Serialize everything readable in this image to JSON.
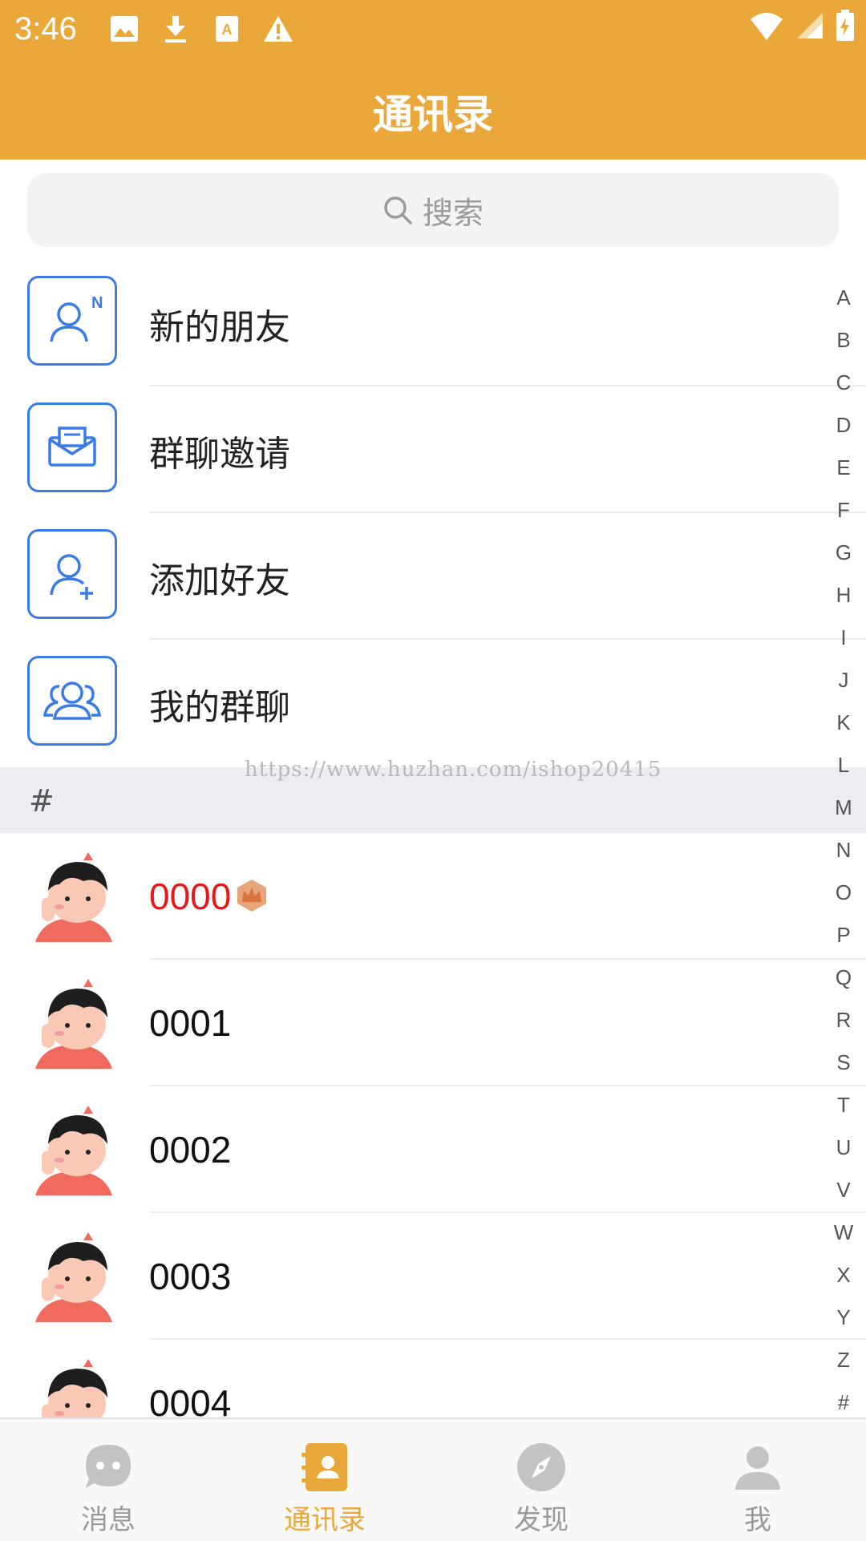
{
  "status_bar": {
    "time": "3:46"
  },
  "header": {
    "title": "通讯录"
  },
  "search": {
    "placeholder": "搜索"
  },
  "functions": [
    {
      "label": "新的朋友",
      "icon": "new-friend-icon"
    },
    {
      "label": "群聊邀请",
      "icon": "group-invite-icon"
    },
    {
      "label": "添加好友",
      "icon": "add-friend-icon"
    },
    {
      "label": "我的群聊",
      "icon": "my-groups-icon"
    }
  ],
  "watermark": "https://www.huzhan.com/ishop20415",
  "section": {
    "letter": "#"
  },
  "contacts": [
    {
      "name": "0000",
      "vip": true
    },
    {
      "name": "0001",
      "vip": false
    },
    {
      "name": "0002",
      "vip": false
    },
    {
      "name": "0003",
      "vip": false
    },
    {
      "name": "0004",
      "vip": false
    }
  ],
  "index_letters": [
    "A",
    "B",
    "C",
    "D",
    "E",
    "F",
    "G",
    "H",
    "I",
    "J",
    "K",
    "L",
    "M",
    "N",
    "O",
    "P",
    "Q",
    "R",
    "S",
    "T",
    "U",
    "V",
    "W",
    "X",
    "Y",
    "Z",
    "#"
  ],
  "nav": [
    {
      "label": "消息",
      "icon": "chat-bubble-icon",
      "active": false
    },
    {
      "label": "通讯录",
      "icon": "contacts-book-icon",
      "active": true
    },
    {
      "label": "发现",
      "icon": "compass-icon",
      "active": false
    },
    {
      "label": "我",
      "icon": "person-icon",
      "active": false
    }
  ],
  "colors": {
    "header": "#EBA83A",
    "accent": "#EBA83A",
    "icon_blue": "#3B7BE8",
    "vip_red": "#E8171A",
    "inactive": "#9A9A9A"
  }
}
